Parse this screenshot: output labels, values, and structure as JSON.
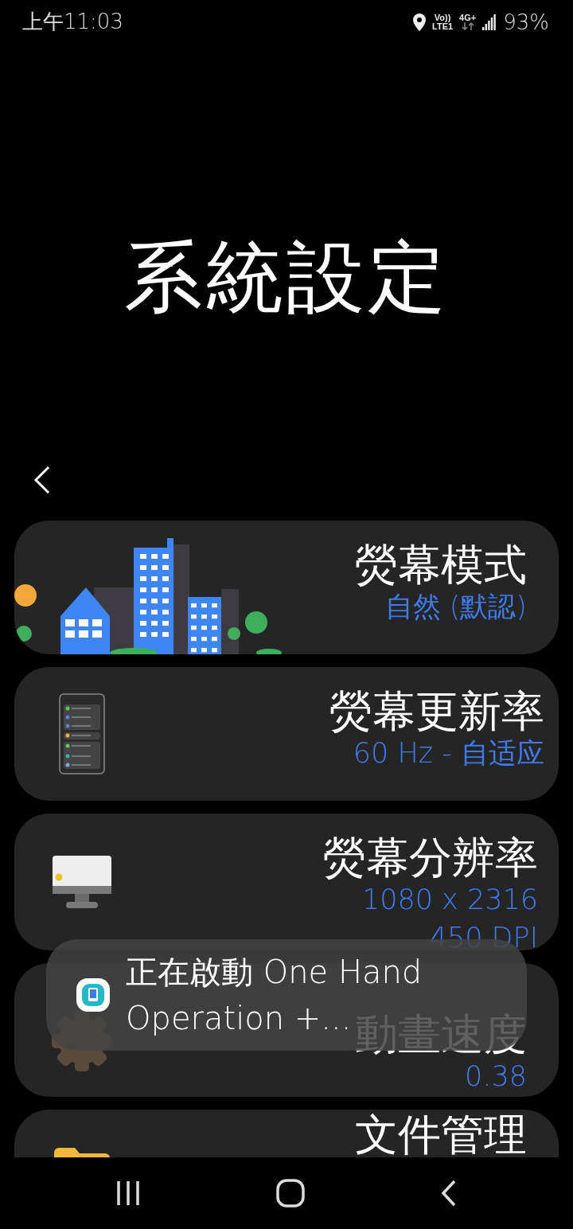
{
  "status_bar": {
    "time": "上午11:03",
    "volte_top": "Vo))",
    "volte_bottom": "LTE1",
    "data_type": "4G+",
    "battery": "93%"
  },
  "title": "系統設定",
  "cards": [
    {
      "kind": "city",
      "title": "熒幕模式",
      "values": [
        "自然 (默認)"
      ]
    },
    {
      "kind": "phone",
      "title": "熒幕更新率",
      "values": [
        "60 Hz - 自适应"
      ]
    },
    {
      "kind": "monitor",
      "title": "熒幕分辨率",
      "values": [
        "1080 x 2316",
        "450 DPI"
      ]
    },
    {
      "kind": "gear",
      "title": "動畫速度",
      "values": [
        "0.38"
      ]
    },
    {
      "kind": "folder",
      "title": "文件管理"
    }
  ],
  "toast": {
    "lines": [
      "正在啟動 One Hand",
      "Operation +..."
    ]
  }
}
